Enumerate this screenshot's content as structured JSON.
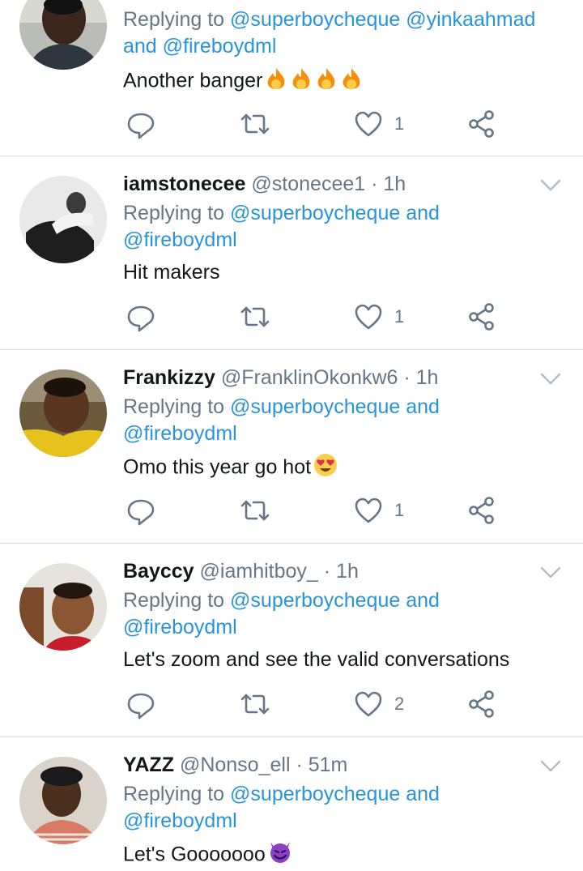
{
  "tweets": [
    {
      "reply_prefix": "Replying to",
      "reply_line1": "@superboycheque @yinkaahmad",
      "reply_and": "and",
      "reply_line2": "@fireboydml",
      "text": "Another banger",
      "emoji": "fire-icon x4",
      "likes": "1"
    },
    {
      "name": "iamstonecee",
      "handle": "@stonecee1",
      "dot": "·",
      "time": "1h",
      "reply_prefix": "Replying to",
      "reply_line1": "@superboycheque",
      "reply_and": "and",
      "reply_line2": "@fireboydml",
      "text": "Hit makers",
      "likes": "1"
    },
    {
      "name": "Frankizzy",
      "handle": "@FranklinOkonkw6",
      "dot": "·",
      "time": "1h",
      "reply_prefix": "Replying to",
      "reply_line1": "@superboycheque",
      "reply_and": "and",
      "reply_line2": "@fireboydml",
      "text": "Omo this year go hot",
      "emoji": "heart-eyes-icon",
      "likes": "1"
    },
    {
      "name": "Bayccy",
      "handle": "@iamhitboy_",
      "dot": "·",
      "time": "1h",
      "reply_prefix": "Replying to",
      "reply_line1": "@superboycheque",
      "reply_and": "and",
      "reply_line2": "@fireboydml",
      "text": "Let's zoom and see the valid conversations",
      "likes": "2"
    },
    {
      "name": "YAZZ",
      "handle": "@Nonso_ell",
      "dot": "·",
      "time": "51m",
      "reply_prefix": "Replying to",
      "reply_line1": "@superboycheque",
      "reply_and": "and",
      "reply_line2": "@fireboydml",
      "text": "Let's Gooooooo",
      "emoji": "smiling-devil-icon"
    }
  ],
  "colors": {
    "link": "#2795d9",
    "muted": "#657786",
    "divider": "#d5dbe0",
    "fire": "#f4900c",
    "devil": "#8a3fc7"
  }
}
